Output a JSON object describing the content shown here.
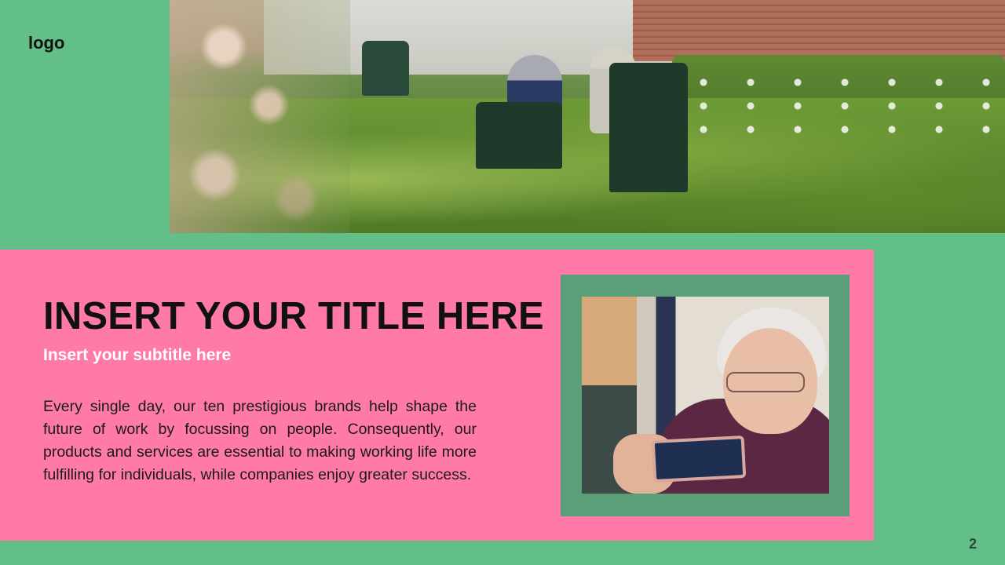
{
  "logo": "logo",
  "title": "INSERT YOUR TITLE HERE",
  "subtitle": "Insert your subtitle here",
  "body": "Every single day, our ten prestigious brands help shape the future of work by focussing on people. Consequently, our products and services are essential to making working life more fulfilling for individuals, while companies enjoy greater success.",
  "page_number": "2",
  "colors": {
    "background": "#63bf88",
    "panel": "#ff7aa7",
    "frame": "#5a9f78",
    "title": "#111111",
    "subtitle": "#ffffff"
  },
  "images": {
    "top_photo": "elderly-people-sitting-in-garden-photo",
    "portrait_photo": "elderly-woman-looking-at-phone-photo"
  }
}
